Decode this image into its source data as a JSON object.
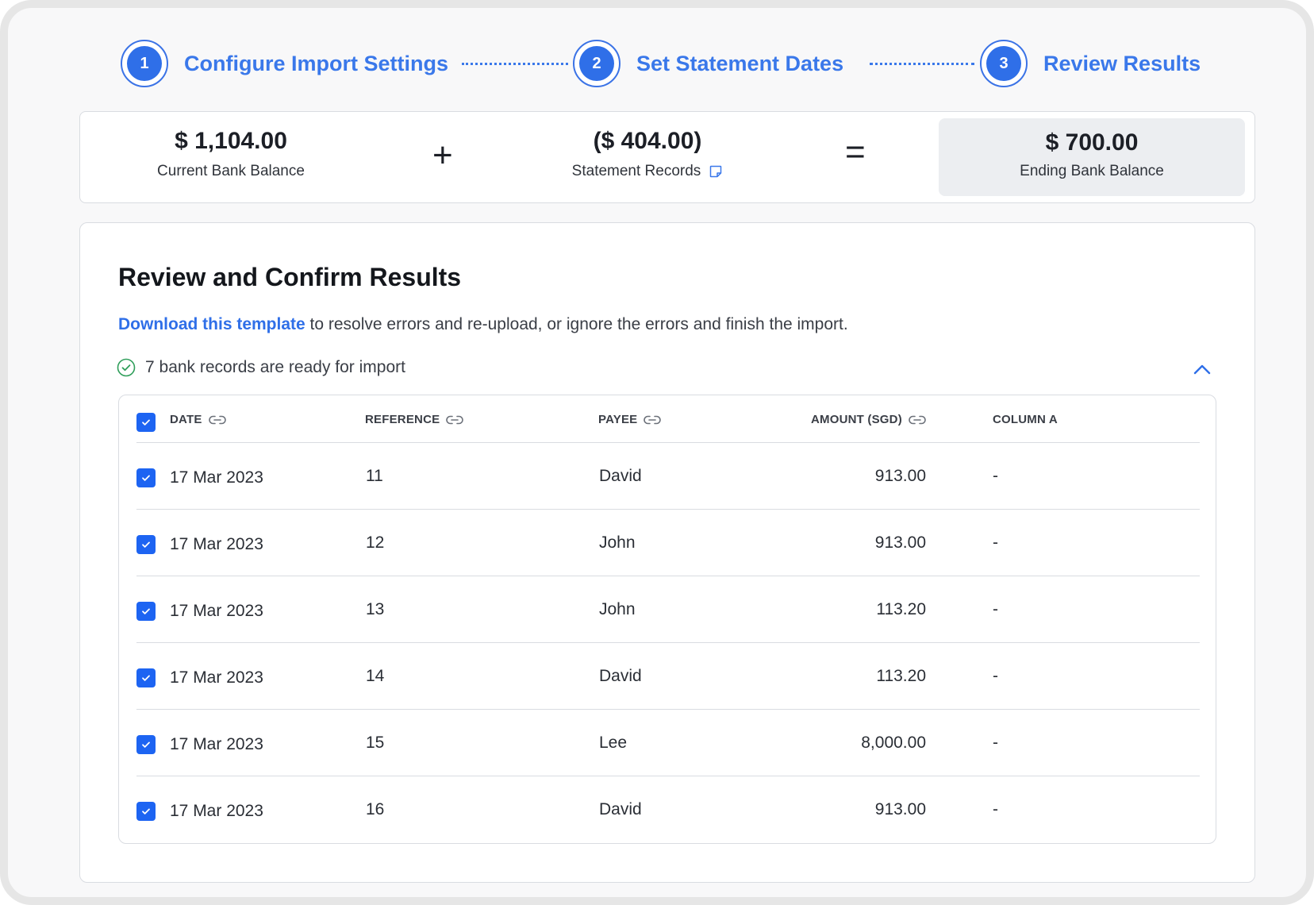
{
  "stepper": {
    "steps": [
      {
        "number": "1",
        "label": "Configure Import Settings"
      },
      {
        "number": "2",
        "label": "Set Statement Dates"
      },
      {
        "number": "3",
        "label": "Review Results"
      }
    ]
  },
  "summary": {
    "current_balance": {
      "value": "$ 1,104.00",
      "label": "Current Bank Balance"
    },
    "plus_symbol": "+",
    "statement_records": {
      "value": "($ 404.00)",
      "label": "Statement Records",
      "icon": "note-icon"
    },
    "equals_symbol": "=",
    "ending_balance": {
      "value": "$ 700.00",
      "label": "Ending Bank Balance"
    }
  },
  "main": {
    "title": "Review and Confirm Results",
    "download_link": "Download this template",
    "description_rest": " to resolve errors and re-upload, or ignore the errors and finish the import.",
    "ready_text": "7 bank records are ready for import"
  },
  "table": {
    "headers": {
      "date": "DATE",
      "reference": "REFERENCE",
      "payee": "PAYEE",
      "amount": "AMOUNT (SGD)",
      "column_a": "COLUMN A"
    },
    "rows": [
      {
        "date": "17 Mar 2023",
        "reference": "11",
        "payee": "David",
        "amount": "913.00",
        "column_a": "-"
      },
      {
        "date": "17 Mar 2023",
        "reference": "12",
        "payee": "John",
        "amount": "913.00",
        "column_a": "-"
      },
      {
        "date": "17 Mar 2023",
        "reference": "13",
        "payee": "John",
        "amount": "113.20",
        "column_a": "-"
      },
      {
        "date": "17 Mar 2023",
        "reference": "14",
        "payee": "David",
        "amount": "113.20",
        "column_a": "-"
      },
      {
        "date": "17 Mar 2023",
        "reference": "15",
        "payee": "Lee",
        "amount": "8,000.00",
        "column_a": "-"
      },
      {
        "date": "17 Mar 2023",
        "reference": "16",
        "payee": "David",
        "amount": "913.00",
        "column_a": "-"
      }
    ]
  },
  "colors": {
    "accent": "#2f6fe8",
    "checkbox": "#1d64f2",
    "success": "#2f9e5a",
    "border": "#d9dce1"
  }
}
